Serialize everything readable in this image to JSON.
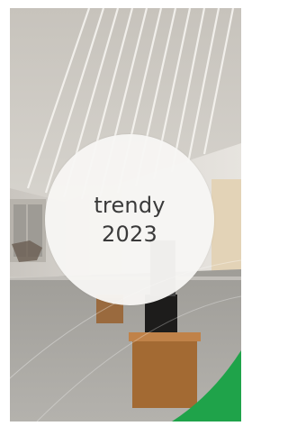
{
  "badge": {
    "line1": "trendy",
    "line2": "2023"
  },
  "colors": {
    "accent_green": "#1fa34a",
    "circle_fill": "#f7f6f4",
    "text": "#3a3a3a"
  }
}
